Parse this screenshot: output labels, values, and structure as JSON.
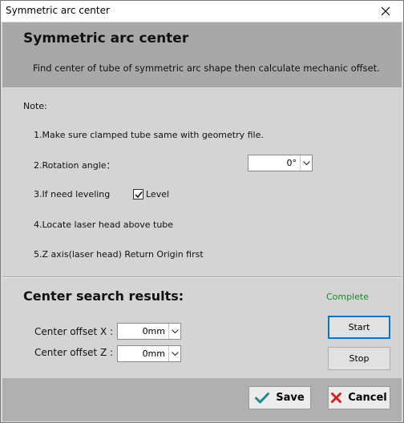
{
  "window": {
    "title": "Symmetric arc center",
    "close_glyph": "✕"
  },
  "header": {
    "title": "Symmetric arc center",
    "description": "Find center of tube of symmetric arc shape then calculate mechanic offset."
  },
  "notes": {
    "heading": "Note:",
    "item1": "1.Make sure clamped tube same with geometry file.",
    "item2": "2.Rotation angle：",
    "rotation_value": "0°",
    "item3": "3.If need leveling",
    "level_label": "Level",
    "level_checked": true,
    "item4": "4.Locate laser head above tube",
    "item5": "5.Z axis(laser head) Return Origin first"
  },
  "results": {
    "title": "Center search results:",
    "status": "Complete",
    "status_color": "#1a8a2a",
    "offset_x_label": "Center offset X :",
    "offset_x_value": "0mm",
    "offset_z_label": "Center offset Z :",
    "offset_z_value": "0mm",
    "start_label": "Start",
    "stop_label": "Stop"
  },
  "footer": {
    "save_label": "Save",
    "cancel_label": "Cancel",
    "save_icon": "check-icon",
    "cancel_icon": "x-icon",
    "save_icon_color": "#1f8a8a",
    "cancel_icon_color": "#d81e1e"
  }
}
